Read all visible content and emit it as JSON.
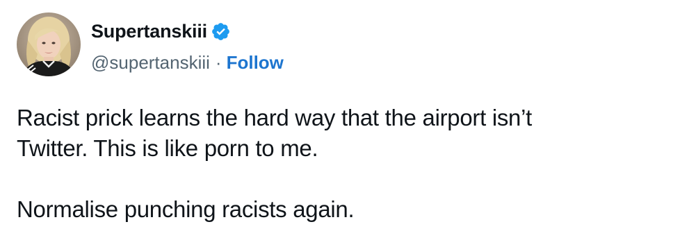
{
  "author": {
    "display_name": "Supertanskiii",
    "handle": "@supertanskiii",
    "verified": true,
    "verified_color": "#1d9bf0"
  },
  "actions": {
    "separator": "·",
    "follow_label": "Follow",
    "follow_color": "#1d75cf"
  },
  "tweet": {
    "line_1": "Racist prick learns the hard way that the airport isn’t",
    "line_2": "Twitter. This is like porn to me.",
    "line_3": "Normalise punching racists again."
  }
}
